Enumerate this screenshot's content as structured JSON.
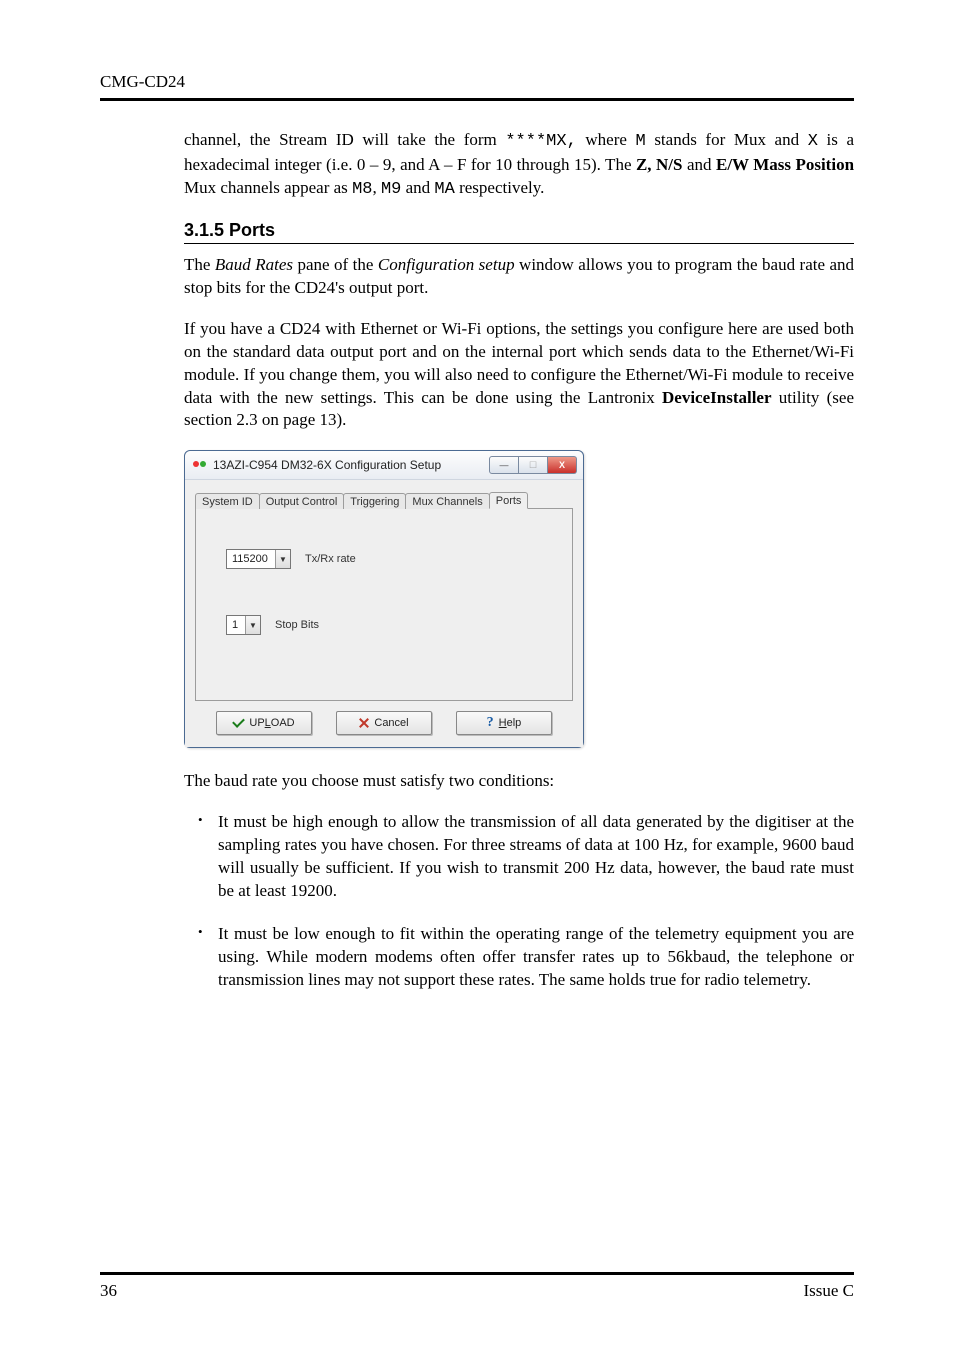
{
  "header": {
    "title": "CMG-CD24"
  },
  "intro": {
    "p1_a": "channel, the Stream ID will take the form ",
    "code1": "****MX,",
    "p1_b": " where ",
    "code2": "M",
    "p1_c": " stands for Mux and ",
    "code3": "X",
    "p1_d": " is a hexadecimal integer (i.e. 0 – 9, and A – F for 10 through 15).   The ",
    "bold1": "Z, N/S",
    "p1_e": " and ",
    "bold2": "E/W Mass Position",
    "p1_f": " Mux channels appear as ",
    "code4": "M8",
    "p1_g": ", ",
    "code5": "M9",
    "p1_h": " and ",
    "code6": "MA",
    "p1_i": " respectively."
  },
  "section": {
    "heading": "3.1.5  Ports",
    "p1_a": "The ",
    "italic1": "Baud Rates",
    "p1_b": " pane of the ",
    "italic2": "Configuration setup",
    "p1_c": " window allows you to program the baud rate and stop bits for the CD24's output port.",
    "p2_a": "If you have a CD24 with Ethernet or Wi-Fi options, the settings you configure here are used both on the standard data output port and on the internal port which sends data to the Ethernet/Wi-Fi module.   If you change them, you will also need to configure the Ethernet/Wi-Fi module to receive data with the new settings.  This can be done using the Lantronix ",
    "bold1": "DeviceInstaller",
    "p2_b": " utility (see section 2.3 on page 13)."
  },
  "dialog": {
    "title": "13AZI-C954 DM32-6X Configuration Setup",
    "tabs": {
      "t1": "System ID",
      "t2": "Output Control",
      "t3": "Triggering",
      "t4": "Mux Channels",
      "t5": "Ports"
    },
    "fields": {
      "baud_value": "115200",
      "baud_label": "Tx/Rx rate",
      "stop_value": "1",
      "stop_label": "Stop Bits"
    },
    "buttons": {
      "upload_pre": "UP",
      "upload_u": "L",
      "upload_post": "OAD",
      "cancel": "Cancel",
      "help_u": "H",
      "help_post": "elp",
      "q": "?"
    },
    "win": {
      "min": "—",
      "max": "☐",
      "close": "X"
    }
  },
  "after": {
    "lead": "The baud rate you choose must satisfy two conditions:",
    "b1": "It must be high enough to allow the transmission of all data generated by the digitiser at the sampling rates you have chosen. For three streams of data at 100 Hz, for example, 9600 baud will usually be sufficient.   If you wish to transmit 200 Hz data, however, the baud rate must be at least 19200.",
    "b2": "It must be low enough to fit within the operating range of the telemetry equipment you are using.   While modern modems often offer transfer rates up to 56kbaud, the telephone or transmission lines may not support these rates.  The same holds true for radio telemetry."
  },
  "footer": {
    "page": "36",
    "issue": "Issue C"
  }
}
